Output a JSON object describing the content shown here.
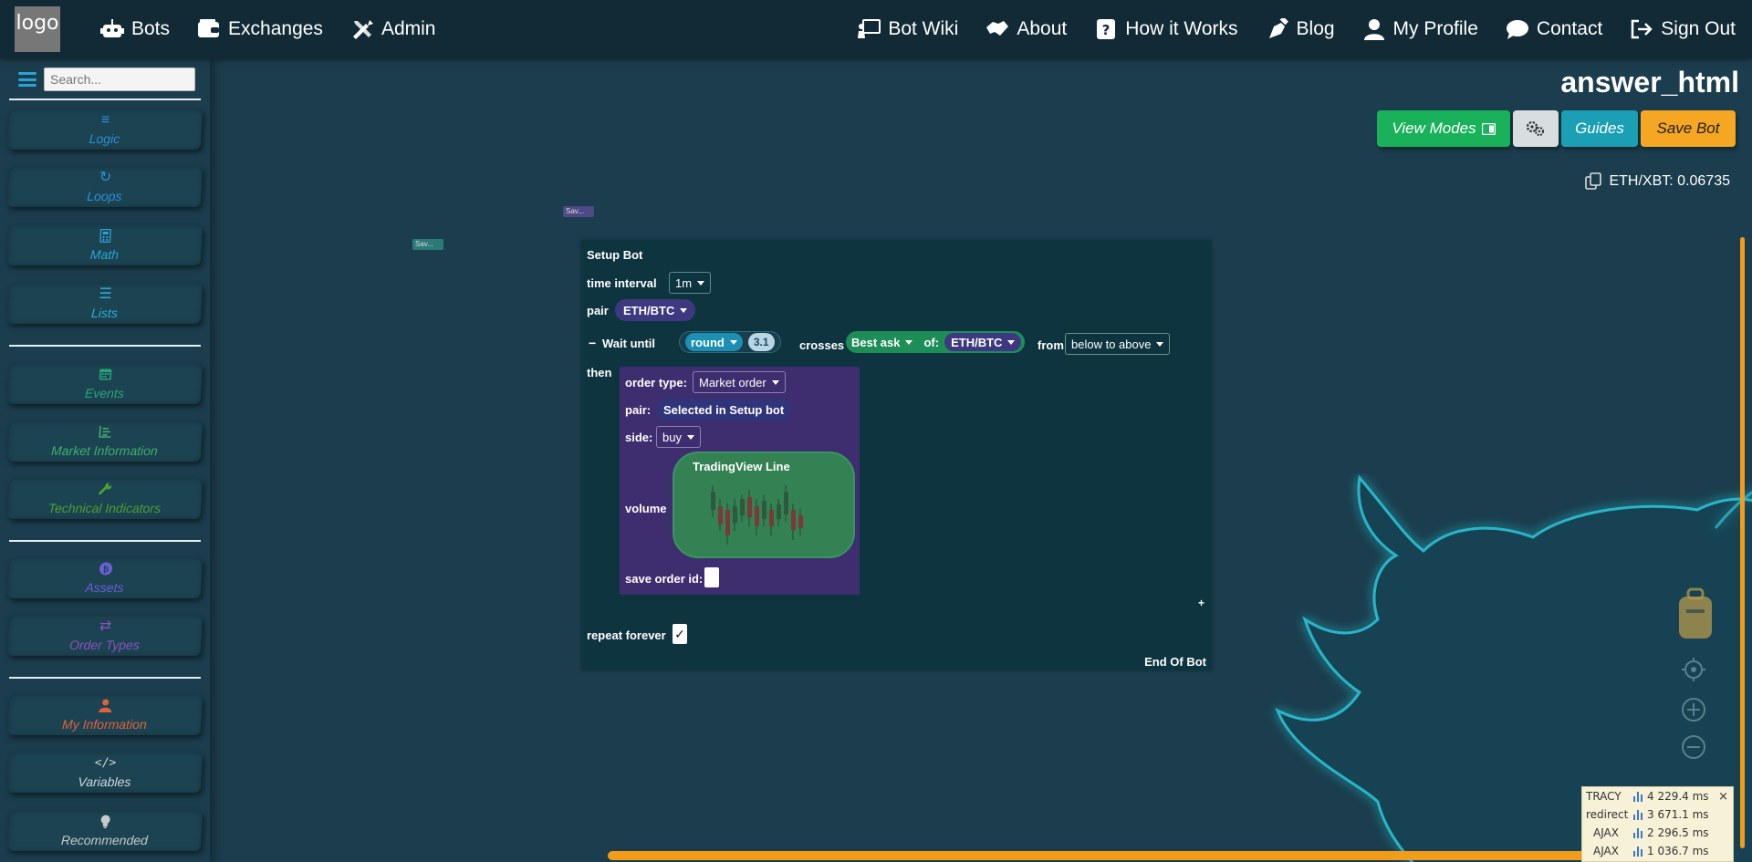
{
  "logo": "logo",
  "nav": {
    "left": [
      {
        "label": "Bots",
        "icon": "robot-icon"
      },
      {
        "label": "Exchanges",
        "icon": "wallet-icon"
      },
      {
        "label": "Admin",
        "icon": "tools-icon"
      }
    ],
    "right": [
      {
        "label": "Bot Wiki",
        "icon": "person-chalkboard-icon"
      },
      {
        "label": "About",
        "icon": "handshake-icon"
      },
      {
        "label": "How it Works",
        "icon": "question-square-icon"
      },
      {
        "label": "Blog",
        "icon": "pen-nib-icon"
      },
      {
        "label": "My Profile",
        "icon": "user-icon"
      },
      {
        "label": "Contact",
        "icon": "comment-icon"
      },
      {
        "label": "Sign Out",
        "icon": "sign-out-icon"
      }
    ]
  },
  "sidebar": {
    "search_placeholder": "Search...",
    "categories": [
      {
        "label": "Logic",
        "icon": "logic-icon",
        "color": "#2b8fd6"
      },
      {
        "label": "Loops",
        "icon": "refresh-icon",
        "color": "#2b8fd6"
      },
      {
        "label": "Math",
        "icon": "calculator-icon",
        "color": "#2aa4d8"
      },
      {
        "label": "Lists",
        "icon": "list-icon",
        "color": "#2aaed8"
      },
      {
        "label": "Events",
        "icon": "calendar-icon",
        "color": "#23a67a"
      },
      {
        "label": "Market Information",
        "icon": "chart-icon",
        "color": "#3fae6a"
      },
      {
        "label": "Technical Indicators",
        "icon": "wrench-icon",
        "color": "#4e9e30"
      },
      {
        "label": "Assets",
        "icon": "bitcoin-icon",
        "color": "#6a5ed6"
      },
      {
        "label": "Order Types",
        "icon": "exchange-arrows-icon",
        "color": "#8a52c2"
      },
      {
        "label": "My Information",
        "icon": "user-icon",
        "color": "#e0623a"
      },
      {
        "label": "Variables",
        "icon": "code-icon",
        "color": "#d0d8dc"
      },
      {
        "label": "Recommended",
        "icon": "lightbulb-icon",
        "color": "#c8c8c8"
      }
    ]
  },
  "header": {
    "title": "answer_html",
    "buttons": {
      "view_modes": "View Modes",
      "settings_icon": "gears-icon",
      "guides": "Guides",
      "save_bot": "Save Bot"
    },
    "ticker": "ETH/XBT: 0.06735"
  },
  "workspace": {
    "mini_blocks": [
      "Sav...",
      "Sav..."
    ],
    "setup": {
      "title": "Setup Bot",
      "time_interval_label": "time interval",
      "time_interval_value": "1m",
      "pair_label": "pair",
      "pair_value": "ETH/BTC",
      "collapse_symbol": "−",
      "wait_until_label": "Wait until",
      "round_label": "round",
      "round_value": "3.1",
      "crosses_label": "crosses",
      "best_ask_label": "Best ask",
      "of_label": "of:",
      "of_pair": "ETH/BTC",
      "from_label": "from",
      "from_value": "below to above",
      "then_label": "then",
      "order": {
        "order_type_label": "order type:",
        "order_type_value": "Market order",
        "pair_label": "pair:",
        "pair_value": "Selected in Setup bot",
        "side_label": "side:",
        "side_value": "buy",
        "volume_label": "volume",
        "tradingview_title": "TradingView Line",
        "save_order_label": "save order id:"
      },
      "plus": "+",
      "repeat_label": "repeat forever",
      "repeat_checked": "✓",
      "end_label": "End Of Bot"
    }
  },
  "tracy": {
    "rows": [
      {
        "k": "TRACY",
        "v": "4 229.4 ms"
      },
      {
        "k": "redirect",
        "v": "3 671.1 ms"
      },
      {
        "k": "AJAX",
        "v": "2 296.5 ms"
      },
      {
        "k": "AJAX",
        "v": "1 036.7 ms"
      }
    ],
    "close": "×"
  }
}
